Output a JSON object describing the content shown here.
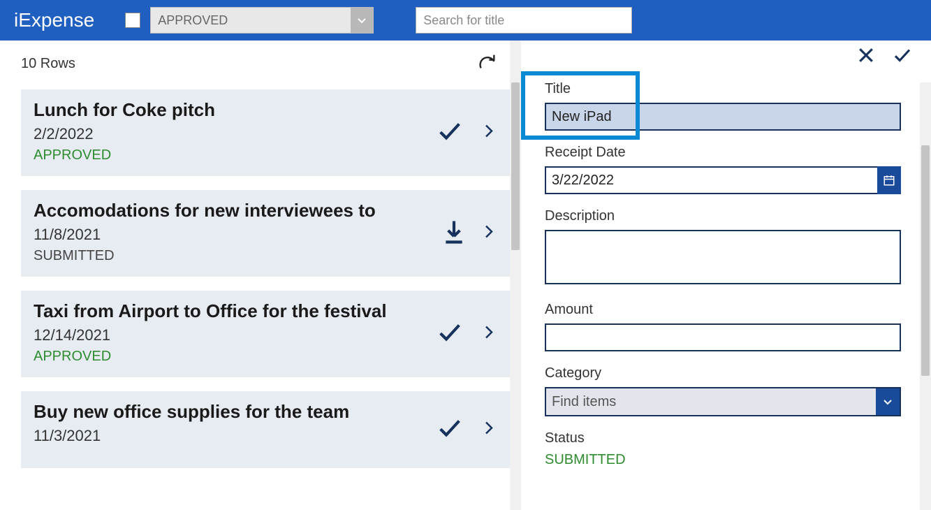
{
  "header": {
    "app_title": "iExpense",
    "status_filter": "APPROVED",
    "search_placeholder": "Search for title"
  },
  "list": {
    "row_count_label": "10 Rows",
    "items": [
      {
        "title": "Lunch for Coke pitch",
        "date": "2/2/2022",
        "status": "APPROVED",
        "action": "approve"
      },
      {
        "title": "Accomodations for new interviewees to",
        "date": "11/8/2021",
        "status": "SUBMITTED",
        "action": "download"
      },
      {
        "title": "Taxi from Airport to Office for the festival",
        "date": "12/14/2021",
        "status": "APPROVED",
        "action": "approve"
      },
      {
        "title": "Buy new office supplies for the team",
        "date": "11/3/2021",
        "status": "",
        "action": "approve"
      }
    ]
  },
  "form": {
    "title_label": "Title",
    "title_value": "New iPad",
    "date_label": "Receipt Date",
    "date_value": "3/22/2022",
    "desc_label": "Description",
    "desc_value": "",
    "amount_label": "Amount",
    "amount_value": "",
    "category_label": "Category",
    "category_placeholder": "Find items",
    "status_label": "Status",
    "status_value": "SUBMITTED"
  }
}
